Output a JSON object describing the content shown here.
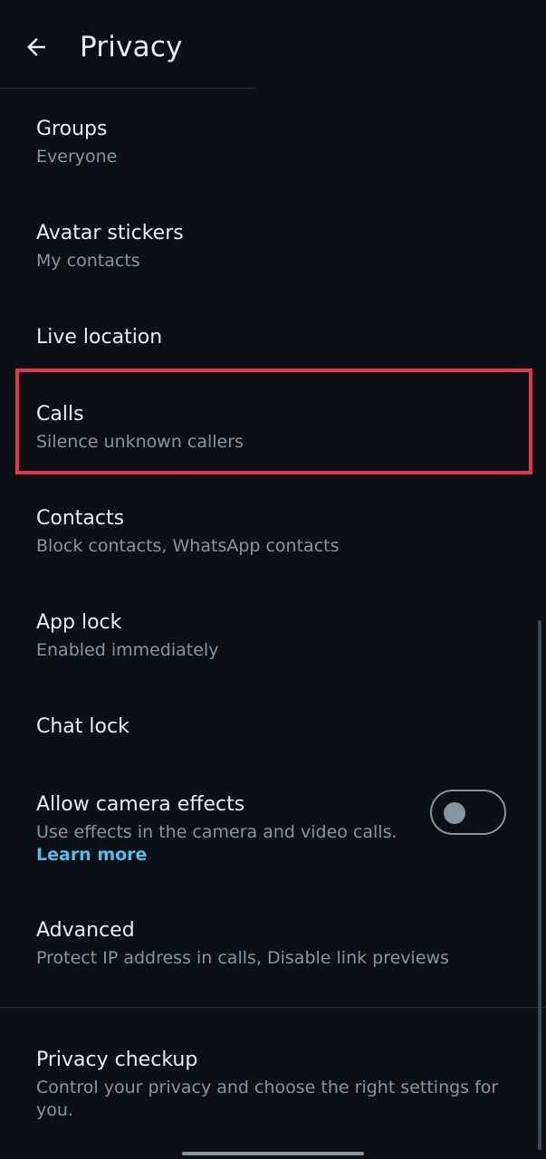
{
  "header": {
    "title": "Privacy",
    "back_icon": "arrow-left-icon"
  },
  "items": [
    {
      "title": "Groups",
      "subtitle": "Everyone"
    },
    {
      "title": "Avatar stickers",
      "subtitle": "My contacts"
    },
    {
      "title": "Live location",
      "subtitle": ""
    },
    {
      "title": "Calls",
      "subtitle": "Silence unknown callers",
      "highlighted": true
    },
    {
      "title": "Contacts",
      "subtitle": "Block contacts, WhatsApp contacts"
    },
    {
      "title": "App lock",
      "subtitle": "Enabled immediately"
    },
    {
      "title": "Chat lock",
      "subtitle": ""
    },
    {
      "title": "Allow camera effects",
      "subtitle": "Use effects in the camera and video calls.",
      "link": "Learn more",
      "toggle_on": false
    },
    {
      "title": "Advanced",
      "subtitle": "Protect IP address in calls, Disable link previews"
    },
    {
      "title": "Privacy checkup",
      "subtitle_line1": "Control your privacy and choose the right settings for",
      "subtitle_line2": "you."
    }
  ],
  "colors": {
    "background": "#0b1014",
    "primary_text": "#e9edef",
    "secondary_text": "#8696a0",
    "link": "#53bdeb",
    "highlight": "#e8344f"
  }
}
